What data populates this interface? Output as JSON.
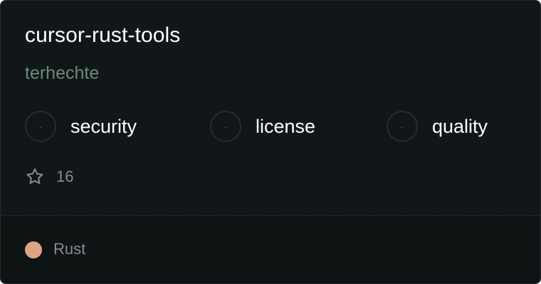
{
  "repo": {
    "name": "cursor-rust-tools",
    "owner": "terhechte"
  },
  "metrics": [
    {
      "symbol": "-",
      "label": "security"
    },
    {
      "symbol": "-",
      "label": "license"
    },
    {
      "symbol": "-",
      "label": "quality"
    }
  ],
  "stars": {
    "icon": "star-icon",
    "count": "16"
  },
  "language": {
    "name": "Rust",
    "color": "#dea584"
  },
  "colors": {
    "card_background": "#111718",
    "owner_text": "#6b8a7b"
  }
}
